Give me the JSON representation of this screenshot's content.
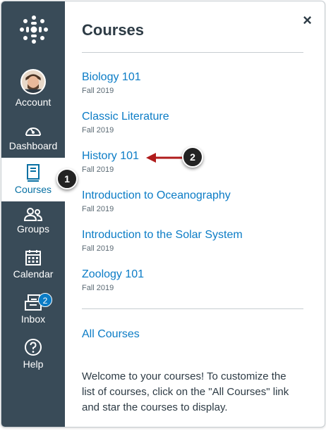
{
  "nav": {
    "items": [
      {
        "label": "Account",
        "icon": "avatar"
      },
      {
        "label": "Dashboard",
        "icon": "speedometer-icon"
      },
      {
        "label": "Courses",
        "icon": "book-icon",
        "active": true
      },
      {
        "label": "Groups",
        "icon": "people-icon"
      },
      {
        "label": "Calendar",
        "icon": "calendar-icon"
      },
      {
        "label": "Inbox",
        "icon": "inbox-icon",
        "badge": "2"
      },
      {
        "label": "Help",
        "icon": "help-icon"
      }
    ]
  },
  "tray": {
    "title": "Courses",
    "close": "×",
    "courses": [
      {
        "name": "Biology 101",
        "term": "Fall 2019"
      },
      {
        "name": "Classic Literature",
        "term": "Fall 2019"
      },
      {
        "name": "History 101",
        "term": "Fall 2019"
      },
      {
        "name": "Introduction to Oceanography",
        "term": "Fall 2019"
      },
      {
        "name": "Introduction to the Solar System",
        "term": "Fall 2019"
      },
      {
        "name": "Zoology 101",
        "term": "Fall 2019"
      }
    ],
    "all_courses": "All Courses",
    "welcome": "Welcome to your courses! To customize the list of courses, click on the \"All Courses\" link and star the courses to display."
  },
  "markers": {
    "one": "1",
    "two": "2"
  },
  "colors": {
    "nav_bg": "#394b58",
    "link": "#0b7cc6",
    "active_text": "#0770a3",
    "arrow": "#b01c1c"
  }
}
